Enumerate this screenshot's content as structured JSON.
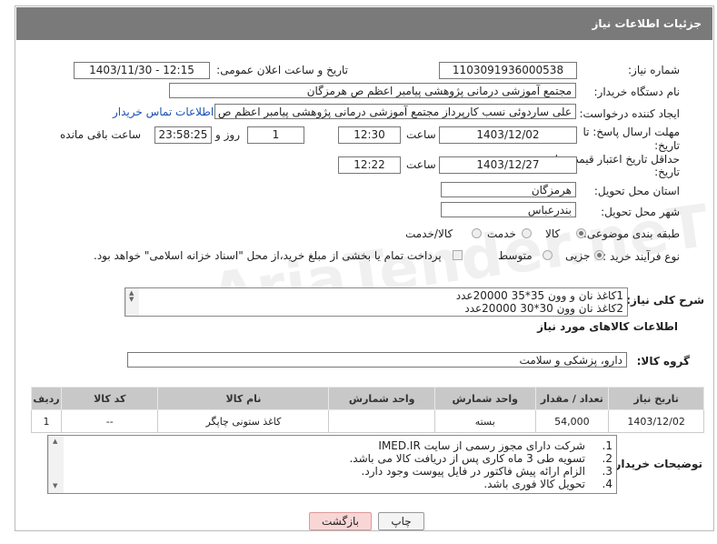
{
  "header": {
    "title": "جزئیات اطلاعات نیاز"
  },
  "fields": {
    "need_number_label": "شماره نیاز:",
    "need_number": "1103091936000538",
    "announce_label": "تاریخ و ساعت اعلان عمومی:",
    "announce_value": "1403/11/30 - 12:15",
    "buyer_org_label": "نام دستگاه خریدار:",
    "buyer_org": "مجتمع آموزشی درمانی پژوهشی پیامبر اعظم ص  هرمزگان",
    "creator_label": "ایجاد کننده درخواست:",
    "creator": "علی ساردوئی نسب کارپرداز مجتمع آموزشی درمانی پژوهشی پیامبر اعظم ص",
    "contact_link": "اطلاعات تماس خریدار",
    "deadline_label_1": "مهلت ارسال پاسخ: تا",
    "deadline_label_2": "تاریخ:",
    "deadline_date": "1403/12/02",
    "time_label": "ساعت",
    "deadline_time": "12:30",
    "days_value": "1",
    "days_label": "روز و",
    "remaining_time": "23:58:25",
    "remaining_label": "ساعت باقی مانده",
    "validity_label_1": "حداقل تاریخ اعتبار قیمت: تا",
    "validity_label_2": "تاریخ:",
    "validity_date": "1403/12/27",
    "validity_time": "12:22",
    "province_label": "استان محل تحویل:",
    "province": "هرمزگان",
    "city_label": "شهر محل تحویل:",
    "city": "بندرعباس",
    "category_label": "طبقه بندی موضوعی:",
    "category_options": [
      "کالا",
      "خدمت",
      "کالا/خدمت"
    ],
    "process_label": "نوع فرآیند خرید :",
    "process_options": [
      "جزیی",
      "متوسط"
    ],
    "payment_note": "پرداخت تمام یا بخشی از مبلغ خرید،از محل \"اسناد خزانه اسلامی\" خواهد بود."
  },
  "description": {
    "label": "شرح کلی نیاز:",
    "line1": "1کاغذ نان و وون 35*35 20000عدد",
    "line2": "2کاغذ نان وون 30*30  20000عدد"
  },
  "goods": {
    "section_title": "اطلاعات کالاهای مورد نیاز",
    "group_label": "گروه کالا:",
    "group_value": "دارو، پزشکی و سلامت",
    "columns": [
      "ردیف",
      "کد کالا",
      "نام کالا",
      "واحد شمارش",
      "تعداد / مقدار",
      "تاریخ نیاز"
    ],
    "rows": [
      {
        "row": "1",
        "code": "--",
        "name": "کاغذ ستونی چاپگر",
        "unit": "بسته",
        "qty": "54,000",
        "date": "1403/12/02"
      }
    ]
  },
  "buyer_notes": {
    "label": "توضیحات خریدار:",
    "items": [
      "شرکت دارای مجوز رسمی از سایت IMED.IR",
      "تسویه طی 3 ماه  کاری پس از دریافت کالا می باشد.",
      "الزام ارائه پیش فاکتور در فایل پیوست وجود دارد.",
      "تحویل کالا فوری باشد."
    ],
    "numbers": [
      "1.",
      "2.",
      "3.",
      "4."
    ]
  },
  "buttons": {
    "print": "چاپ",
    "back": "بازگشت"
  },
  "watermark": "AriaTender.neT"
}
